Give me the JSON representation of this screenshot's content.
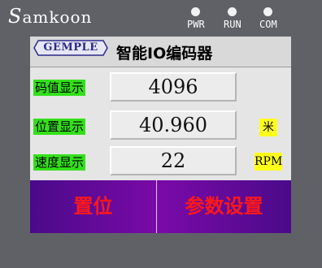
{
  "device": {
    "brand_initial": "S",
    "brand_rest": "amkoon",
    "indicators": [
      {
        "label": "PWR"
      },
      {
        "label": "RUN"
      },
      {
        "label": "COM"
      }
    ]
  },
  "header": {
    "logo_text": "GEMPLE",
    "title": "智能IO编码器"
  },
  "rows": [
    {
      "label": "码值显示",
      "value": "4096",
      "unit": ""
    },
    {
      "label": "位置显示",
      "value": "40.960",
      "unit": "米"
    },
    {
      "label": "速度显示",
      "value": "22",
      "unit": "RPM"
    }
  ],
  "buttons": {
    "reset": "置位",
    "parameters": "参数设置"
  },
  "colors": {
    "label_bg": "#33e01a",
    "unit_bg": "#ffff1a",
    "button_text": "#ff1818",
    "button_bar": "#7a0aa8"
  }
}
